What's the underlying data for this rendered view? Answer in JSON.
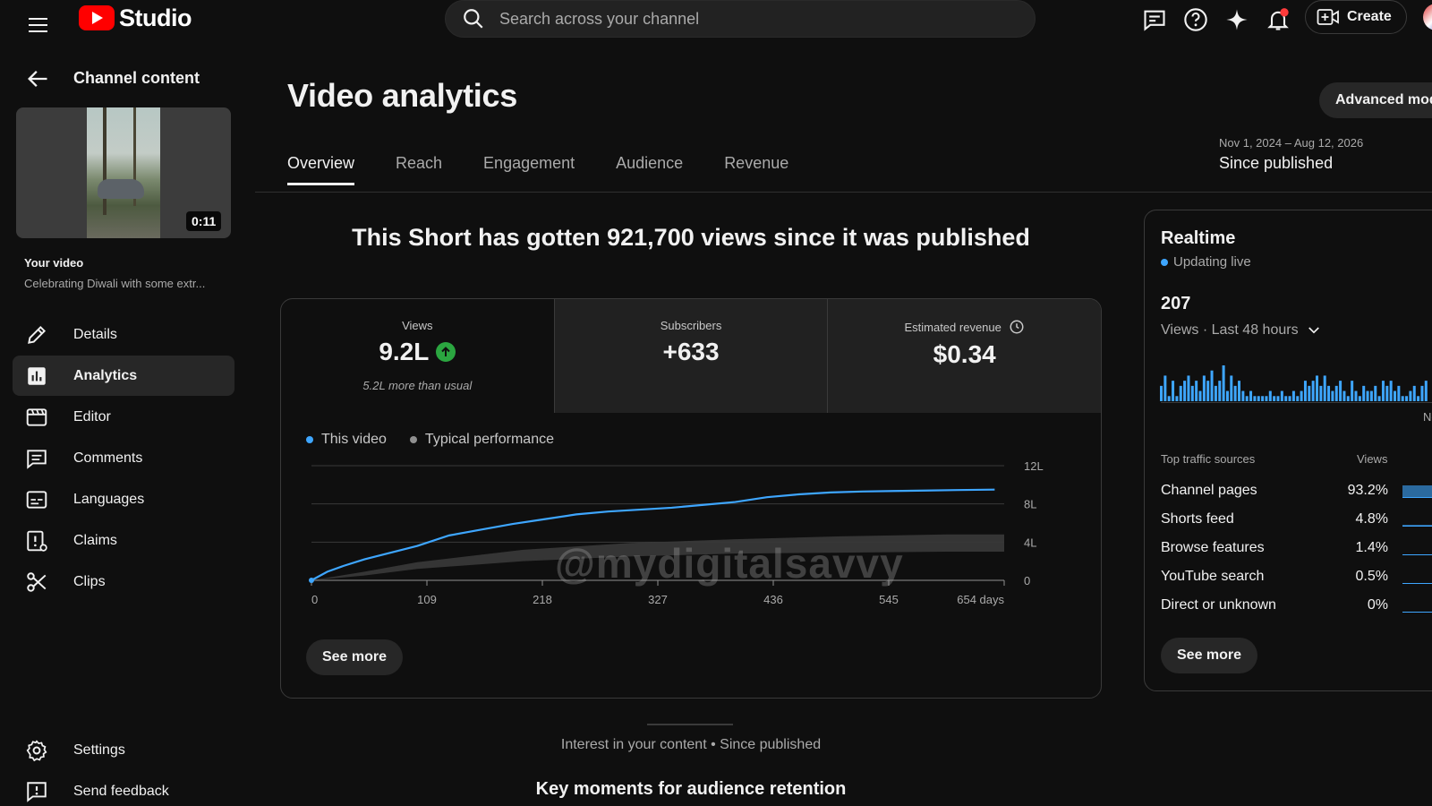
{
  "header": {
    "logo_text": "Studio",
    "search_placeholder": "Search across your channel",
    "create_label": "Create"
  },
  "sidebar": {
    "title": "Channel content",
    "video_duration": "0:11",
    "your_video_label": "Your video",
    "video_title": "Celebrating Diwali with some extr...",
    "items": [
      {
        "label": "Details",
        "icon": "pencil-icon"
      },
      {
        "label": "Analytics",
        "icon": "analytics-icon",
        "active": true
      },
      {
        "label": "Editor",
        "icon": "clapperboard-icon"
      },
      {
        "label": "Comments",
        "icon": "comment-icon"
      },
      {
        "label": "Languages",
        "icon": "subtitles-icon"
      },
      {
        "label": "Claims",
        "icon": "claims-icon"
      },
      {
        "label": "Clips",
        "icon": "scissors-icon"
      }
    ],
    "bottom_items": [
      {
        "label": "Settings",
        "icon": "gear-icon"
      },
      {
        "label": "Send feedback",
        "icon": "feedback-icon"
      }
    ]
  },
  "main": {
    "page_title": "Video analytics",
    "advanced_mode_label": "Advanced mode",
    "date_range": "Nov 1, 2024 – Aug 12, 2026",
    "period_label": "Since published",
    "tabs": [
      "Overview",
      "Reach",
      "Engagement",
      "Audience",
      "Revenue"
    ],
    "active_tab": "Overview",
    "headline": "This Short has gotten 921,700 views since it was published",
    "metrics": {
      "views": {
        "label": "Views",
        "value": "9.2L",
        "note": "5.2L more than usual"
      },
      "subscribers": {
        "label": "Subscribers",
        "value": "+633"
      },
      "revenue": {
        "label": "Estimated revenue",
        "value": "$0.34"
      }
    },
    "legend": {
      "this_video": "This video",
      "typical": "Typical performance"
    },
    "see_more_label": "See more",
    "watermark": "@mydigitalsavvy",
    "interest_text": "Interest in your content • Since published",
    "key_moments_title": "Key moments for audience retention"
  },
  "chart_data": {
    "type": "line",
    "x_tick_labels": [
      "0",
      "109",
      "218",
      "327",
      "436",
      "545",
      "654 days"
    ],
    "y_tick_labels": [
      "0",
      "4L",
      "8L",
      "12L"
    ],
    "xlim": [
      0,
      654
    ],
    "ylim": [
      0,
      12
    ],
    "grid": true,
    "legend_position": "top-left",
    "series": [
      {
        "name": "This video",
        "color": "#3ea6ff",
        "x": [
          0,
          15,
          30,
          50,
          75,
          100,
          130,
          160,
          190,
          220,
          250,
          280,
          310,
          340,
          370,
          400,
          430,
          460,
          490,
          520,
          550,
          580,
          610,
          645
        ],
        "y": [
          0,
          0.9,
          1.5,
          2.2,
          2.9,
          3.6,
          4.7,
          5.3,
          5.9,
          6.4,
          6.9,
          7.2,
          7.4,
          7.6,
          7.9,
          8.2,
          8.7,
          9.0,
          9.2,
          9.3,
          9.35,
          9.4,
          9.45,
          9.5
        ]
      },
      {
        "name": "Typical performance",
        "color": "#3a3a3a",
        "x": [
          0,
          50,
          100,
          200,
          300,
          400,
          500,
          600,
          654
        ],
        "y_low": [
          0,
          0.5,
          1.2,
          2.0,
          2.5,
          2.8,
          2.9,
          3.0,
          3.0
        ],
        "y_high": [
          0,
          0.9,
          1.9,
          3.2,
          3.9,
          4.3,
          4.6,
          4.8,
          4.8
        ]
      }
    ]
  },
  "realtime": {
    "title": "Realtime",
    "live_label": "Updating live",
    "live_color": "#3ea6ff",
    "count": "207",
    "range_label": "Views · Last 48 hours",
    "bars": [
      3,
      5,
      1,
      4,
      1,
      3,
      4,
      5,
      3,
      4,
      2,
      5,
      4,
      6,
      3,
      4,
      7,
      2,
      5,
      3,
      4,
      2,
      1,
      2,
      1,
      1,
      1,
      1,
      2,
      1,
      1,
      2,
      1,
      1,
      2,
      1,
      2,
      4,
      3,
      4,
      5,
      3,
      5,
      3,
      2,
      3,
      4,
      2,
      1,
      4,
      2,
      1,
      3,
      2,
      2,
      3,
      1,
      4,
      3,
      4,
      2,
      3,
      1,
      1,
      2,
      3,
      1,
      3,
      4
    ],
    "partial_label": "No",
    "traffic_header": "Top traffic sources",
    "traffic_views_header": "Views",
    "traffic_sources": [
      {
        "name": "Channel pages",
        "value": "93.2%",
        "share": 0.932
      },
      {
        "name": "Shorts feed",
        "value": "4.8%",
        "share": 0.048
      },
      {
        "name": "Browse features",
        "value": "1.4%",
        "share": 0.014
      },
      {
        "name": "YouTube search",
        "value": "0.5%",
        "share": 0.005
      },
      {
        "name": "Direct or unknown",
        "value": "0%",
        "share": 0
      }
    ],
    "see_more_label": "See more"
  }
}
